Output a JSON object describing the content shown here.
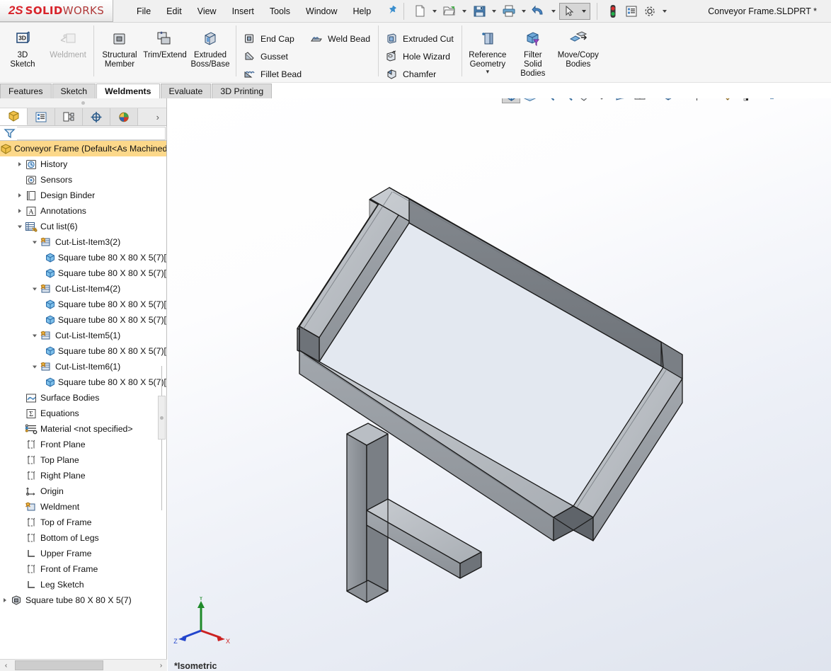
{
  "app": {
    "brand_ds": "2S",
    "brand_main": "SOLID",
    "brand_light": "WORKS",
    "document_title": "Conveyor Frame.SLDPRT *"
  },
  "menu": {
    "items": [
      {
        "label": "File"
      },
      {
        "label": "Edit"
      },
      {
        "label": "View"
      },
      {
        "label": "Insert"
      },
      {
        "label": "Tools"
      },
      {
        "label": "Window"
      },
      {
        "label": "Help"
      }
    ],
    "pin_icon": "pushpin-icon"
  },
  "quickaccess": {
    "buttons": [
      {
        "name": "new-document-button",
        "icon": "new-file-icon",
        "dropdown": true
      },
      {
        "name": "open-document-button",
        "icon": "open-folder-icon",
        "dropdown": true
      },
      {
        "name": "save-button",
        "icon": "floppy-save-icon",
        "dropdown": true
      },
      {
        "name": "print-button",
        "icon": "printer-icon",
        "dropdown": true
      },
      {
        "name": "undo-button",
        "icon": "undo-arrow-icon",
        "dropdown": true
      },
      {
        "name": "select-tool-button",
        "icon": "cursor-arrow-icon",
        "dropdown": true
      },
      {
        "name": "rebuild-button",
        "icon": "traffic-light-icon",
        "dropdown": false
      },
      {
        "name": "file-properties-button",
        "icon": "properties-list-icon",
        "dropdown": false
      },
      {
        "name": "options-button",
        "icon": "gear-icon",
        "dropdown": true
      }
    ]
  },
  "ribbon": {
    "groups": [
      {
        "type": "big",
        "commands": [
          {
            "label": "3D\nSketch",
            "label_lines": [
              "3D",
              "Sketch"
            ],
            "icon": "3d-sketch-icon",
            "disabled": false
          },
          {
            "label": "Weldment",
            "label_lines": [
              "Weldment"
            ],
            "icon": "weldment-icon",
            "disabled": true
          }
        ]
      },
      {
        "type": "big",
        "commands": [
          {
            "label_lines": [
              "Structural",
              "Member"
            ],
            "icon": "structural-member-icon",
            "disabled": false
          },
          {
            "label_lines": [
              "Trim/Extend"
            ],
            "icon": "trim-extend-icon",
            "disabled": false
          },
          {
            "label_lines": [
              "Extruded",
              "Boss/Base"
            ],
            "icon": "extruded-boss-icon",
            "disabled": false
          }
        ]
      },
      {
        "type": "small-2col",
        "col1": [
          {
            "label": "End Cap",
            "icon": "end-cap-icon"
          },
          {
            "label": "Gusset",
            "icon": "gusset-icon"
          },
          {
            "label": "Fillet Bead",
            "icon": "fillet-bead-icon"
          }
        ],
        "col2": [
          {
            "label": "Weld Bead",
            "icon": "weld-bead-icon"
          }
        ]
      },
      {
        "type": "small-1col",
        "col1": [
          {
            "label": "Extruded Cut",
            "icon": "extruded-cut-icon"
          },
          {
            "label": "Hole Wizard",
            "icon": "hole-wizard-icon"
          },
          {
            "label": "Chamfer",
            "icon": "chamfer-icon"
          }
        ]
      },
      {
        "type": "big",
        "commands": [
          {
            "label_lines": [
              "Reference",
              "Geometry"
            ],
            "icon": "reference-geometry-icon",
            "dropdown": true
          },
          {
            "label_lines": [
              "Filter",
              "Solid",
              "Bodies"
            ],
            "icon": "filter-solid-bodies-icon"
          },
          {
            "label_lines": [
              "Move/Copy",
              "Bodies"
            ],
            "icon": "move-copy-bodies-icon"
          }
        ]
      }
    ]
  },
  "command_tabs": [
    {
      "label": "Features",
      "active": false
    },
    {
      "label": "Sketch",
      "active": false
    },
    {
      "label": "Weldments",
      "active": true
    },
    {
      "label": "Evaluate",
      "active": false
    },
    {
      "label": "3D Printing",
      "active": false
    }
  ],
  "panel_tabs": [
    {
      "name": "feature-manager-tab",
      "icon": "feature-tree-icon",
      "active": true
    },
    {
      "name": "property-manager-tab",
      "icon": "property-list-icon",
      "active": false
    },
    {
      "name": "configuration-manager-tab",
      "icon": "configuration-icon",
      "active": false
    },
    {
      "name": "dimxpert-manager-tab",
      "icon": "dimxpert-target-icon",
      "active": false
    },
    {
      "name": "display-manager-tab",
      "icon": "display-sphere-icon",
      "active": false
    }
  ],
  "panel_more_icon": "chevron-right-icon",
  "filter": {
    "icon": "funnel-filter-icon",
    "value": "",
    "placeholder": ""
  },
  "tree": {
    "items": [
      {
        "label": "Conveyor Frame  (Default<As Machined",
        "icon": "part-icon",
        "indent": 0,
        "arrow": "none",
        "selected": true
      },
      {
        "label": "History",
        "icon": "history-icon",
        "indent": 1,
        "arrow": "collapsed"
      },
      {
        "label": "Sensors",
        "icon": "sensors-icon",
        "indent": 1,
        "arrow": "none"
      },
      {
        "label": "Design Binder",
        "icon": "design-binder-icon",
        "indent": 1,
        "arrow": "collapsed"
      },
      {
        "label": "Annotations",
        "icon": "annotations-icon",
        "indent": 1,
        "arrow": "collapsed"
      },
      {
        "label": "Cut list(6)",
        "icon": "cut-list-icon",
        "indent": 1,
        "arrow": "expanded"
      },
      {
        "label": "Cut-List-Item3(2)",
        "icon": "cut-list-item-icon",
        "indent": 2,
        "arrow": "expanded"
      },
      {
        "label": "Square tube 80 X 80 X 5(7)[",
        "icon": "solid-body-icon",
        "indent": 3,
        "arrow": "none"
      },
      {
        "label": "Square tube 80 X 80 X 5(7)[",
        "icon": "solid-body-icon",
        "indent": 3,
        "arrow": "none"
      },
      {
        "label": "Cut-List-Item4(2)",
        "icon": "cut-list-item-icon",
        "indent": 2,
        "arrow": "expanded"
      },
      {
        "label": "Square tube 80 X 80 X 5(7)[",
        "icon": "solid-body-icon",
        "indent": 3,
        "arrow": "none"
      },
      {
        "label": "Square tube 80 X 80 X 5(7)[",
        "icon": "solid-body-icon",
        "indent": 3,
        "arrow": "none"
      },
      {
        "label": "Cut-List-Item5(1)",
        "icon": "cut-list-item-icon",
        "indent": 2,
        "arrow": "expanded"
      },
      {
        "label": "Square tube 80 X 80 X 5(7)[",
        "icon": "solid-body-icon",
        "indent": 3,
        "arrow": "none"
      },
      {
        "label": "Cut-List-Item6(1)",
        "icon": "cut-list-item-icon",
        "indent": 2,
        "arrow": "expanded"
      },
      {
        "label": "Square tube 80 X 80 X 5(7)[",
        "icon": "solid-body-icon",
        "indent": 3,
        "arrow": "none"
      },
      {
        "label": "Surface Bodies",
        "icon": "surface-bodies-icon",
        "indent": 1,
        "arrow": "none"
      },
      {
        "label": "Equations",
        "icon": "equations-icon",
        "indent": 1,
        "arrow": "none"
      },
      {
        "label": "Material <not specified>",
        "icon": "material-icon",
        "indent": 1,
        "arrow": "none"
      },
      {
        "label": "Front Plane",
        "icon": "plane-icon",
        "indent": 1,
        "arrow": "none"
      },
      {
        "label": "Top Plane",
        "icon": "plane-icon",
        "indent": 1,
        "arrow": "none"
      },
      {
        "label": "Right Plane",
        "icon": "plane-icon",
        "indent": 1,
        "arrow": "none"
      },
      {
        "label": "Origin",
        "icon": "origin-icon",
        "indent": 1,
        "arrow": "none"
      },
      {
        "label": "Weldment",
        "icon": "weldment-feature-icon",
        "indent": 1,
        "arrow": "none"
      },
      {
        "label": "Top of Frame",
        "icon": "plane-icon",
        "indent": 1,
        "arrow": "none"
      },
      {
        "label": "Bottom of Legs",
        "icon": "plane-icon",
        "indent": 1,
        "arrow": "none"
      },
      {
        "label": "Upper Frame",
        "icon": "sketch-icon",
        "indent": 1,
        "arrow": "none"
      },
      {
        "label": "Front of Frame",
        "icon": "plane-icon",
        "indent": 1,
        "arrow": "none"
      },
      {
        "label": "Leg Sketch",
        "icon": "sketch-icon",
        "indent": 1,
        "arrow": "none"
      },
      {
        "label": "Square tube 80 X 80 X 5(7)",
        "icon": "structural-member-feature-icon",
        "indent": 0,
        "arrow": "collapsed"
      }
    ]
  },
  "view_toolbar": {
    "buttons": [
      {
        "name": "view-orientation-button",
        "icon": "isometric-cube-icon",
        "active": true,
        "dropdown": false
      },
      {
        "name": "previous-view-button",
        "icon": "normal-to-icon",
        "active": false,
        "dropdown": false
      },
      {
        "name": "zoom-to-fit-button",
        "icon": "zoom-fit-icon",
        "active": false,
        "dropdown": false
      },
      {
        "name": "zoom-to-area-button",
        "icon": "zoom-area-icon",
        "active": false,
        "dropdown": false
      },
      {
        "name": "view-rotate-button",
        "icon": "magnifier-star-icon",
        "active": false,
        "dropdown": false
      },
      {
        "name": "pan-button",
        "icon": "rotate-view-icon",
        "active": false,
        "dropdown": false
      },
      {
        "name": "section-view-button",
        "icon": "section-view-icon",
        "active": false,
        "dropdown": false
      },
      {
        "name": "view-orientation-menu-button",
        "icon": "view-orientation-icon",
        "active": false,
        "dropdown": true
      },
      {
        "name": "display-style-button",
        "icon": "display-style-cube-icon",
        "active": false,
        "dropdown": true
      },
      {
        "name": "hide-show-items-button",
        "icon": "hide-show-eye-icon",
        "active": false,
        "dropdown": true
      },
      {
        "name": "edit-appearance-button",
        "icon": "appearance-pencil-icon",
        "active": false,
        "dropdown": false
      },
      {
        "name": "apply-scene-button",
        "icon": "scene-checkered-icon",
        "active": false,
        "dropdown": true
      },
      {
        "name": "view-settings-button",
        "icon": "monitor-icon",
        "active": false,
        "dropdown": true
      }
    ]
  },
  "viewport": {
    "orientation_label": "*Isometric",
    "triad": {
      "x_label": "X",
      "y_label": "Y",
      "z_label": "Z",
      "x_color": "#cc2222",
      "y_color": "#1f8a2a",
      "z_color": "#2244cc"
    },
    "model_name": "conveyor-frame-weldment",
    "colors": {
      "body_light": "#cfd2d6",
      "body_mid": "#9fa4aa",
      "body_dark": "#74797f",
      "edge": "#1a1a1a",
      "background_top": "#ffffff",
      "background_bottom": "#dfe4ee"
    }
  },
  "hscrollbar": {
    "left_arrow": "‹",
    "right_arrow": "›"
  }
}
